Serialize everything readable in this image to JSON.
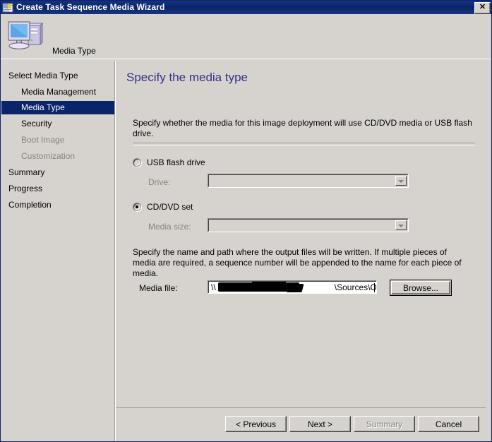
{
  "window": {
    "title": "Create Task Sequence Media Wizard",
    "title_icon": "wizard-app-icon",
    "close_label": "✕"
  },
  "header": {
    "title": "Media Type",
    "icon": "computer-icon"
  },
  "sidebar": {
    "items": [
      {
        "label": "Select Media Type",
        "indent": false,
        "state": "normal"
      },
      {
        "label": "Media Management",
        "indent": true,
        "state": "normal"
      },
      {
        "label": "Media Type",
        "indent": true,
        "state": "selected"
      },
      {
        "label": "Security",
        "indent": true,
        "state": "normal"
      },
      {
        "label": "Boot Image",
        "indent": true,
        "state": "disabled"
      },
      {
        "label": "Customization",
        "indent": true,
        "state": "disabled"
      },
      {
        "label": "Summary",
        "indent": false,
        "state": "normal"
      },
      {
        "label": "Progress",
        "indent": false,
        "state": "normal"
      },
      {
        "label": "Completion",
        "indent": false,
        "state": "normal"
      }
    ]
  },
  "content": {
    "heading": "Specify the media type",
    "description": "Specify whether the media for this image deployment will use CD/DVD media or USB flash drive.",
    "usb_radio_label": "USB flash drive",
    "usb_selected": false,
    "drive_label": "Drive:",
    "drive_value": "",
    "cd_radio_label": "CD/DVD set",
    "cd_selected": true,
    "media_size_label": "Media size:",
    "media_size_value": "",
    "path_description": "Specify the name and path where the output files will be written.  If multiple pieces of media are required, a sequence number will be appended to the name for each piece of media.",
    "media_file_label": "Media file:",
    "media_file_prefix": "\\\\",
    "media_file_value": "\\Sources\\OSD\\boot_image",
    "browse_label": "Browse..."
  },
  "footer": {
    "previous_label": "< Previous",
    "next_label": "Next >",
    "summary_label": "Summary",
    "summary_disabled": true,
    "cancel_label": "Cancel"
  },
  "colors": {
    "titlebar": "#0a246a",
    "face": "#d6d3ce",
    "heading": "#32328c",
    "selection": "#0a246a",
    "disabled_text": "#868482"
  }
}
